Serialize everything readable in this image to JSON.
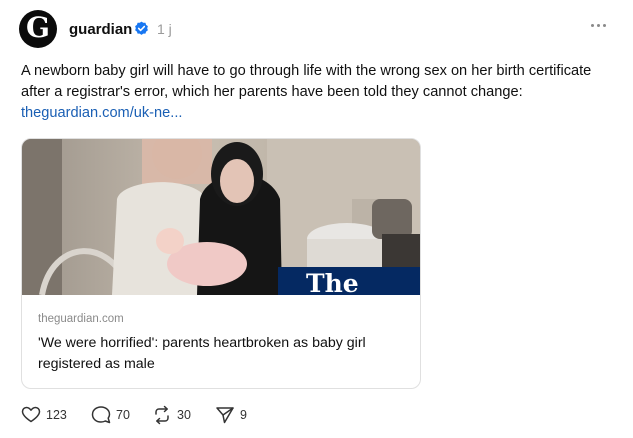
{
  "post": {
    "username": "guardian",
    "avatar_letter": "G",
    "time": "1 j",
    "text": "A newborn baby girl will have to go through life with the wrong sex on her birth certificate after a registrar's error, which her parents have been told they cannot change:",
    "link": "theguardian.com/uk-ne..."
  },
  "card": {
    "domain": "theguardian.com",
    "title": "'We were horrified': parents heartbroken as baby girl registered as male",
    "image_logo": "The Guardian"
  },
  "actions": {
    "likes": "123",
    "replies": "70",
    "reposts": "30",
    "shares": "9"
  },
  "icons": {
    "verified": "verified-badge-icon",
    "more": "more-options-icon",
    "like": "heart-icon",
    "reply": "comment-bubble-icon",
    "repost": "repost-icon",
    "share": "send-icon"
  },
  "colors": {
    "verified": "#1877f2",
    "link": "#1a5fb4",
    "guardian_blue": "#052962"
  }
}
